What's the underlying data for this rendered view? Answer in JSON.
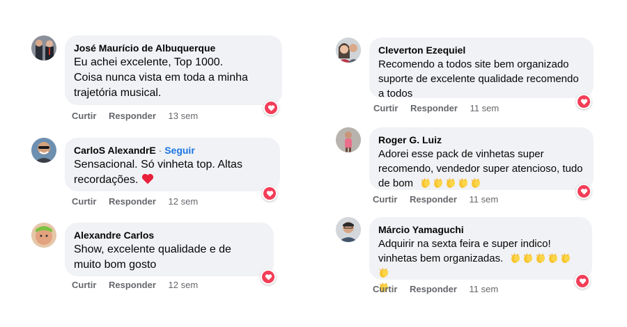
{
  "left_comments": [
    {
      "author": "José Maurício de Albuquerque",
      "lines": [
        "Eu achei excelente, Top 1000.",
        "Coisa nunca vista em toda a minha",
        "trajetória musical."
      ],
      "like": "Curtir",
      "reply": "Responder",
      "time": "13 sem",
      "reaction": "heart-icon"
    },
    {
      "author": "CarloS AlexandrE",
      "separator": "·",
      "follow": "Seguir",
      "lines": [
        "Sensacional. Só vinheta top. Altas",
        "recordações."
      ],
      "like": "Curtir",
      "reply": "Responder",
      "time": "12 sem",
      "reaction": "heart-icon"
    },
    {
      "author": "Alexandre Carlos",
      "lines": [
        "Show, excelente qualidade e de",
        "muito bom gosto"
      ],
      "like": "Curtir",
      "reply": "Responder",
      "time": "12 sem",
      "reaction": "heart-icon"
    }
  ],
  "right_comments": [
    {
      "author": "Cleverton Ezequiel",
      "lines": [
        "Recomendo a todos site bem organizado",
        "suporte de excelente qualidade recomendo",
        "a todos"
      ],
      "like": "Curtir",
      "reply": "Responder",
      "time": "11 sem",
      "reaction": "heart-icon"
    },
    {
      "author": "Roger G. Luiz",
      "lines": [
        "Adorei esse pack de vinhetas super",
        "recomendo, vendedor super atencioso, tudo",
        "de bom"
      ],
      "like": "Curtir",
      "reply": "Responder",
      "time": "11 sem",
      "reaction": "heart-icon"
    },
    {
      "author": "Márcio Yamaguchi",
      "lines": [
        "Adquirir na sexta feira e super indico!",
        "vinhetas bem organizadas."
      ],
      "like": "Curtir",
      "reply": "Responder",
      "time": "11 sem",
      "reaction": "heart-icon"
    }
  ],
  "colors": {
    "bubble": "#f0f2f5",
    "meta": "#65676b",
    "follow": "#1b74e4",
    "reaction": "#f33e58"
  }
}
